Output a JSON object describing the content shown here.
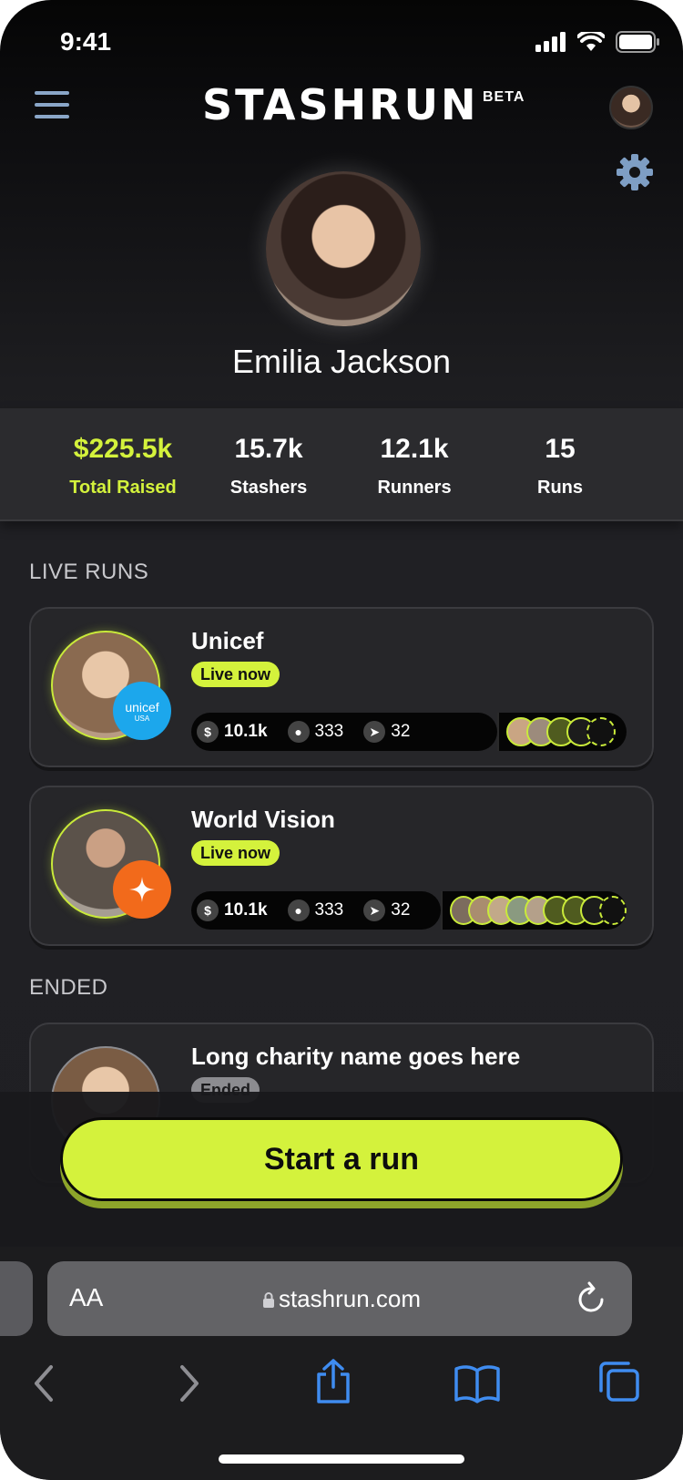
{
  "status_bar": {
    "time": "9:41"
  },
  "header": {
    "logo": "STASHRUN",
    "beta": "BETA"
  },
  "profile": {
    "name": "Emilia Jackson"
  },
  "stats": [
    {
      "value": "$225.5k",
      "label": "Total Raised",
      "accent": true
    },
    {
      "value": "15.7k",
      "label": "Stashers"
    },
    {
      "value": "12.1k",
      "label": "Runners"
    },
    {
      "value": "15",
      "label": "Runs"
    }
  ],
  "sections": {
    "live": "LIVE RUNS",
    "ended": "ENDED"
  },
  "live_runs": [
    {
      "name": "Unicef",
      "status": "Live now",
      "org_badge": "unicef",
      "org_badge_sub": "USA",
      "raised": "10.1k",
      "stashers": "333",
      "runners": "32"
    },
    {
      "name": "World Vision",
      "status": "Live now",
      "org_badge": "star-icon",
      "raised": "10.1k",
      "stashers": "333",
      "runners": "32"
    }
  ],
  "ended_runs": [
    {
      "name": "Long charity name goes here",
      "status": "Ended"
    }
  ],
  "cta": {
    "label": "Start a run"
  },
  "browser": {
    "aa": "AA",
    "url": "stashrun.com"
  },
  "colors": {
    "accent": "#d4f23c",
    "background": "#1f1f23",
    "unicef_blue": "#1ca7ec",
    "worldvision_orange": "#f26a1b",
    "ios_blue": "#3f8cf0"
  }
}
